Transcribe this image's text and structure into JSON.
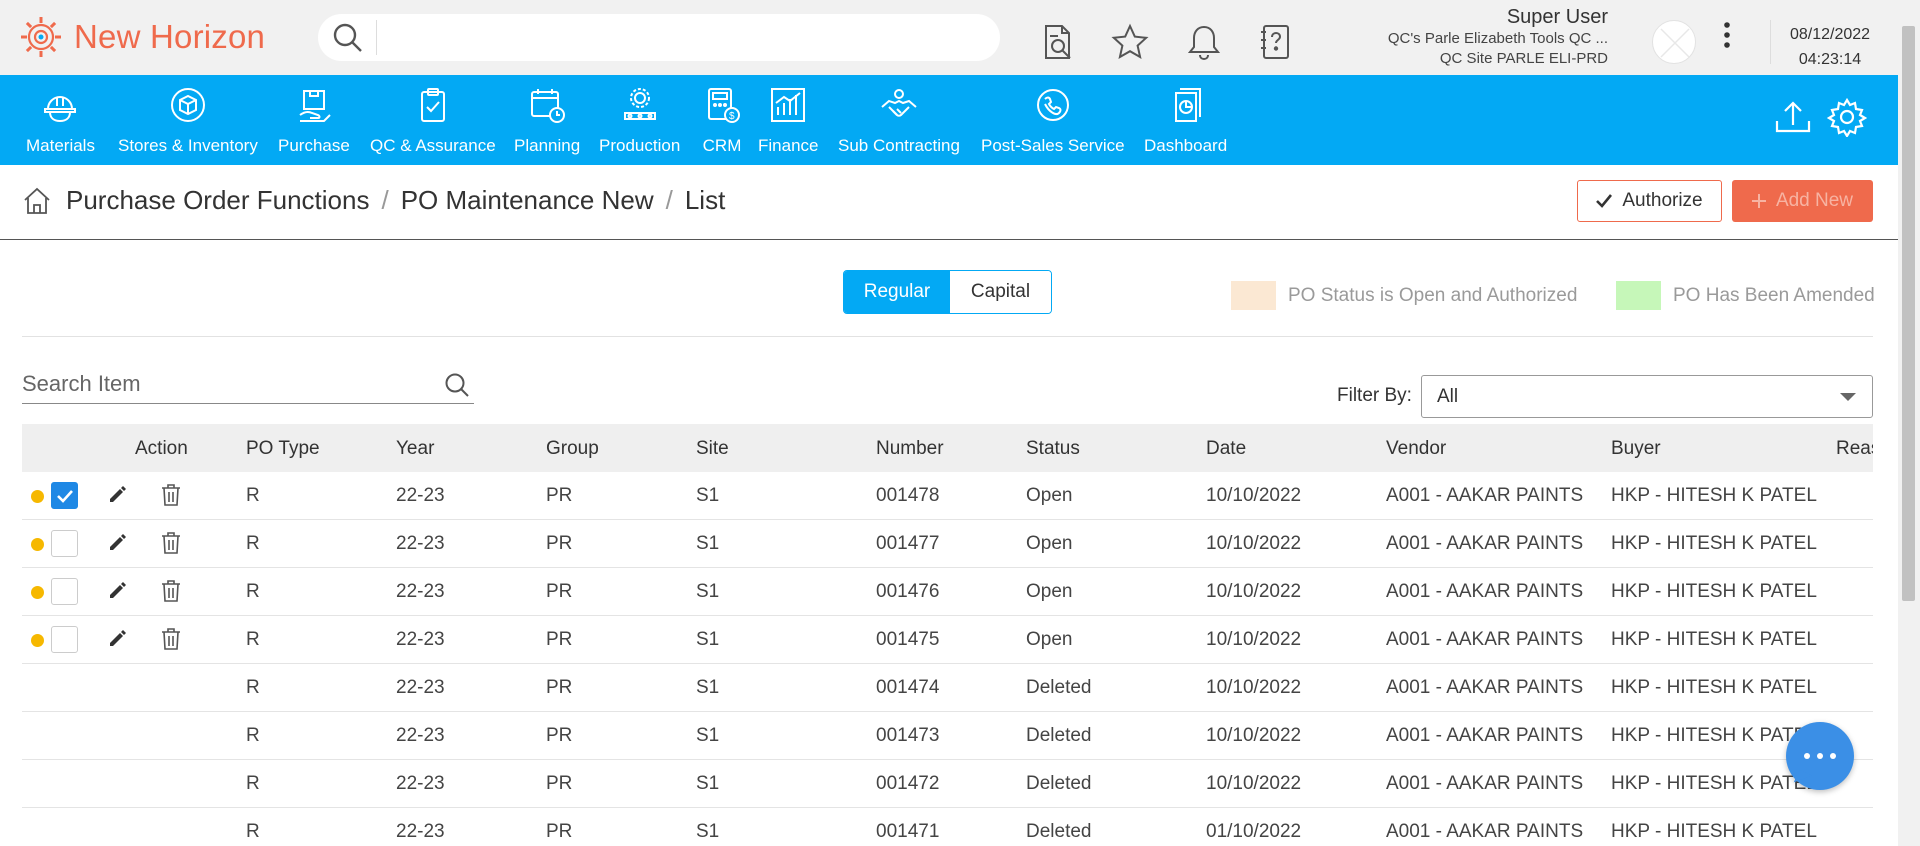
{
  "app": {
    "name": "New Horizon"
  },
  "header": {
    "search_placeholder": "",
    "user_name": "Super User",
    "company": "QC's Parle Elizabeth Tools QC ...",
    "site": "QC Site PARLE ELI-PRD",
    "date": "08/12/2022",
    "time": "04:23:14"
  },
  "nav": [
    {
      "label": "Materials"
    },
    {
      "label": "Stores & Inventory"
    },
    {
      "label": "Purchase"
    },
    {
      "label": "QC & Assurance"
    },
    {
      "label": "Planning"
    },
    {
      "label": "Production"
    },
    {
      "label": "CRM"
    },
    {
      "label": "Finance"
    },
    {
      "label": "Sub Contracting"
    },
    {
      "label": "Post-Sales Service"
    },
    {
      "label": "Dashboard"
    }
  ],
  "breadcrumb": [
    "Purchase Order Functions",
    "PO Maintenance New",
    "List"
  ],
  "actions": {
    "authorize": "Authorize",
    "add_new": "Add New"
  },
  "toggle": {
    "regular": "Regular",
    "capital": "Capital"
  },
  "legend": {
    "open_authorized": {
      "label": "PO Status is Open and Authorized",
      "color": "#fbe8d3"
    },
    "amended": {
      "label": "PO Has Been Amended",
      "color": "#c6f7b9"
    }
  },
  "search_item": {
    "placeholder": "Search Item"
  },
  "filter": {
    "label": "Filter By:",
    "value": "All"
  },
  "table": {
    "columns": [
      "Action",
      "PO Type",
      "Year",
      "Group",
      "Site",
      "Number",
      "Status",
      "Date",
      "Vendor",
      "Buyer",
      "Reas"
    ],
    "rows": [
      {
        "po_type": "R",
        "year": "22-23",
        "group": "PR",
        "site": "S1",
        "number": "001478",
        "status": "Open",
        "date": "10/10/2022",
        "vendor": "A001 - AAKAR PAINTS",
        "buyer": "HKP - HITESH K PATEL"
      },
      {
        "po_type": "R",
        "year": "22-23",
        "group": "PR",
        "site": "S1",
        "number": "001477",
        "status": "Open",
        "date": "10/10/2022",
        "vendor": "A001 - AAKAR PAINTS",
        "buyer": "HKP - HITESH K PATEL"
      },
      {
        "po_type": "R",
        "year": "22-23",
        "group": "PR",
        "site": "S1",
        "number": "001476",
        "status": "Open",
        "date": "10/10/2022",
        "vendor": "A001 - AAKAR PAINTS",
        "buyer": "HKP - HITESH K PATEL"
      },
      {
        "po_type": "R",
        "year": "22-23",
        "group": "PR",
        "site": "S1",
        "number": "001475",
        "status": "Open",
        "date": "10/10/2022",
        "vendor": "A001 - AAKAR PAINTS",
        "buyer": "HKP - HITESH K PATEL"
      },
      {
        "po_type": "R",
        "year": "22-23",
        "group": "PR",
        "site": "S1",
        "number": "001474",
        "status": "Deleted",
        "date": "10/10/2022",
        "vendor": "A001 - AAKAR PAINTS",
        "buyer": "HKP - HITESH K PATEL"
      },
      {
        "po_type": "R",
        "year": "22-23",
        "group": "PR",
        "site": "S1",
        "number": "001473",
        "status": "Deleted",
        "date": "10/10/2022",
        "vendor": "A001 - AAKAR PAINTS",
        "buyer": "HKP - HITESH K PATEL"
      },
      {
        "po_type": "R",
        "year": "22-23",
        "group": "PR",
        "site": "S1",
        "number": "001472",
        "status": "Deleted",
        "date": "10/10/2022",
        "vendor": "A001 - AAKAR PAINTS",
        "buyer": "HKP - HITESH K PATEL"
      },
      {
        "po_type": "R",
        "year": "22-23",
        "group": "PR",
        "site": "S1",
        "number": "001471",
        "status": "Deleted",
        "date": "01/10/2022",
        "vendor": "A001 - AAKAR PAINTS",
        "buyer": "HKP - HITESH K PATEL"
      }
    ]
  },
  "colors": {
    "brand": "#ef6a4c",
    "nav_bg": "#03a9f4",
    "status_dot": "#f6b800",
    "checkbox_checked": "#1e88e5"
  }
}
